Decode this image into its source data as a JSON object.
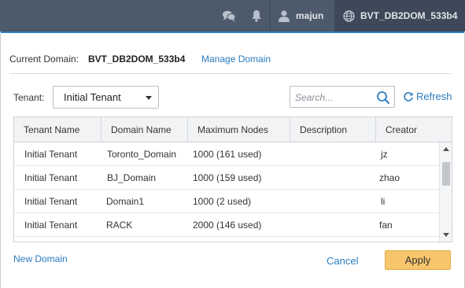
{
  "topbar": {
    "icons": [
      "chat-icon",
      "bell-icon",
      "user-icon",
      "globe-icon"
    ],
    "user_name": "majun",
    "domain_name": "BVT_DB2DOM_533b4"
  },
  "dialog": {
    "current_domain_label": "Current Domain:",
    "current_domain_value": "BVT_DB2DOM_533b4",
    "manage_link": "Manage Domain",
    "tenant_label": "Tenant:",
    "tenant_selected": "Initial Tenant",
    "search_placeholder": "Search...",
    "refresh_label": "Refresh",
    "table": {
      "columns": [
        "Tenant Name",
        "Domain Name",
        "Maximum Nodes",
        "Description",
        "Creator"
      ],
      "rows": [
        [
          "Initial Tenant",
          "Toronto_Domain",
          "1000 (161 used)",
          "",
          "jz"
        ],
        [
          "Initial Tenant",
          "BJ_Domain",
          "1000 (159 used)",
          "",
          "zhao"
        ],
        [
          "Initial Tenant",
          "Domain1",
          "1000 (2 used)",
          "",
          "li"
        ],
        [
          "Initial Tenant",
          "RACK",
          "2000 (146 used)",
          "",
          "fan"
        ]
      ]
    },
    "new_domain_link": "New Domain",
    "cancel_label": "Cancel",
    "apply_label": "Apply"
  },
  "colors": {
    "topbar": "#4d5a6b",
    "accent": "#2d7fc4",
    "link": "#2a7cc0",
    "apply": "#f7c56b"
  }
}
